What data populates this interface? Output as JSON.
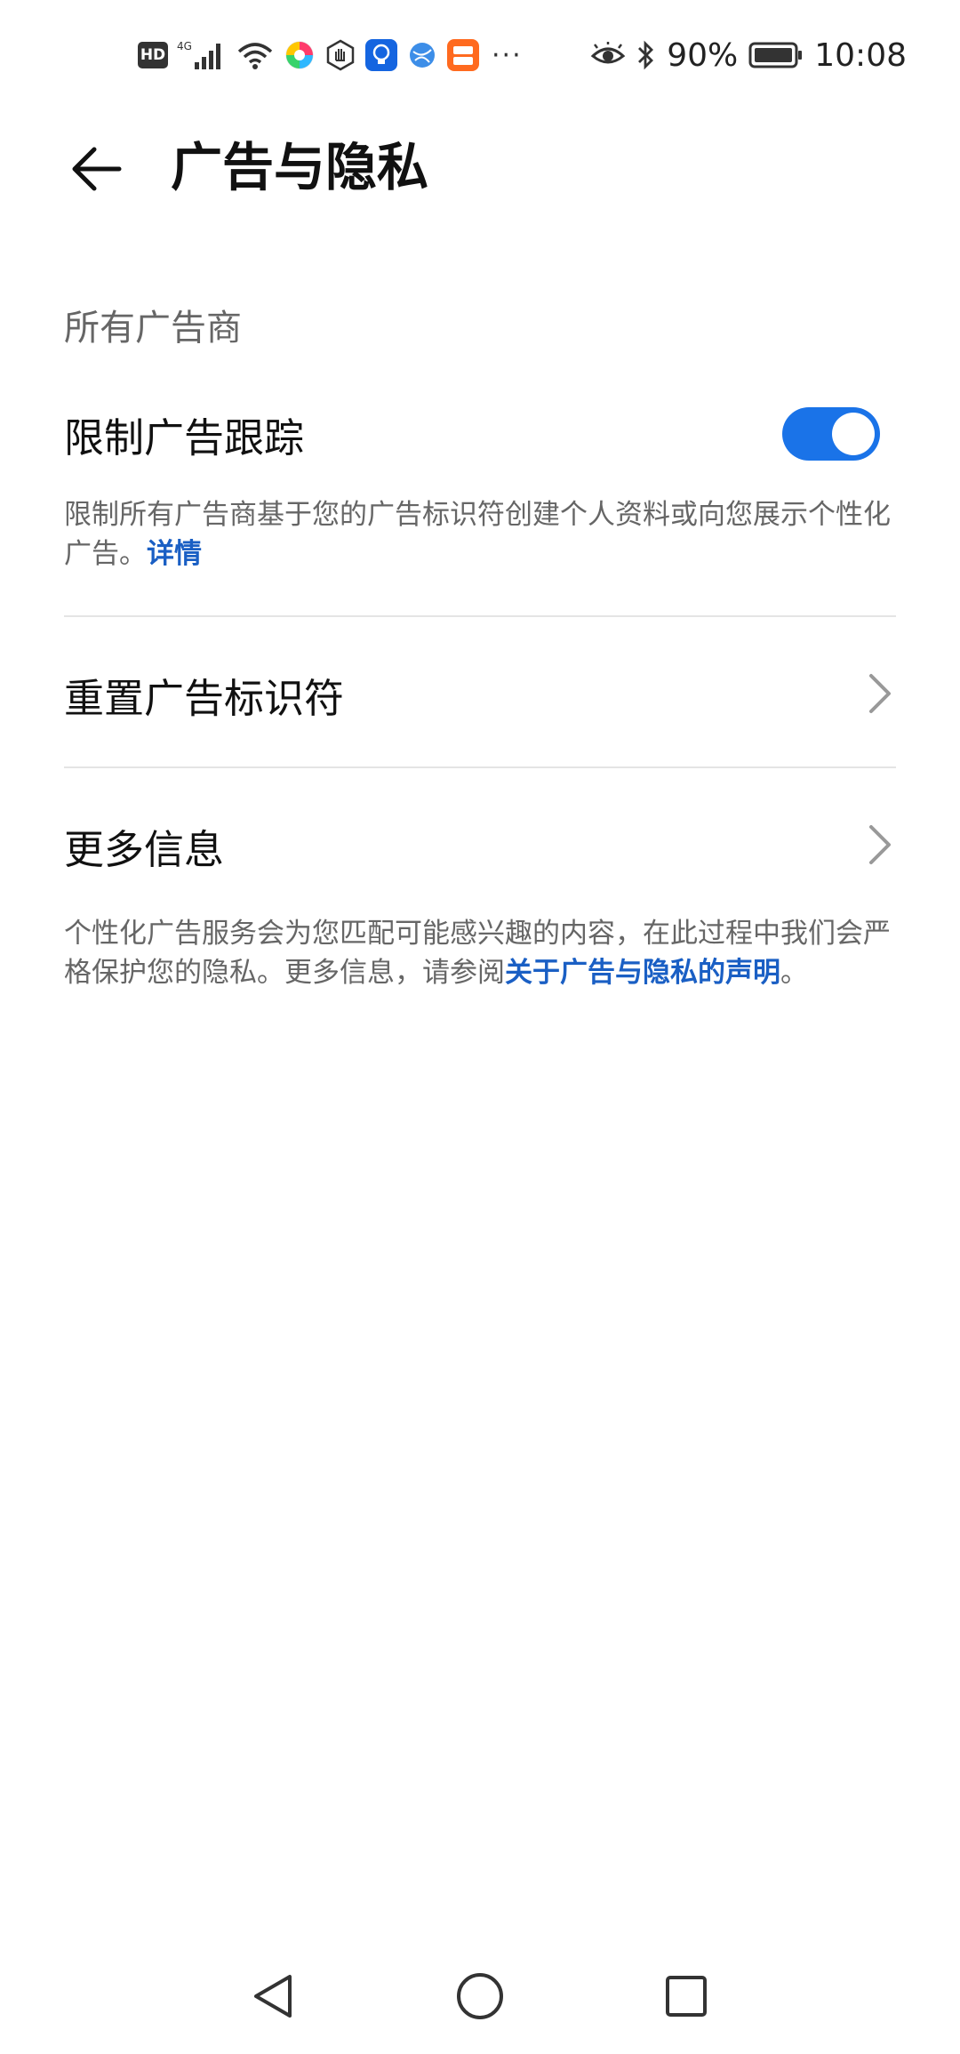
{
  "status_bar": {
    "battery": "90%",
    "time": "10:08",
    "left_icons": [
      "hd-badge",
      "4g-signal-icon",
      "wifi-icon",
      "app-icon-1",
      "app-icon-2",
      "app-icon-3",
      "app-icon-4",
      "app-icon-5"
    ],
    "right_icons": [
      "eye-icon",
      "bluetooth-icon",
      "battery-icon"
    ],
    "hd_label": "HD",
    "more": "···"
  },
  "header": {
    "title": "广告与隐私"
  },
  "section": {
    "label": "所有广告商"
  },
  "limit_tracking": {
    "title": "限制广告跟踪",
    "enabled": true,
    "description": "限制所有广告商基于您的广告标识符创建个人资料或向您展示个性化广告。",
    "link_label": "详情"
  },
  "reset_id": {
    "title": "重置广告标识符"
  },
  "more_info": {
    "title": "更多信息"
  },
  "footer_note": {
    "text": "个性化广告服务会为您匹配可能感兴趣的内容，在此过程中我们会严格保护您的隐私。更多信息，请参阅",
    "link_label": "关于广告与隐私的声明",
    "suffix": "。"
  },
  "colors": {
    "accent": "#1a73e8",
    "link": "#1a5fc4",
    "text_primary": "#111111",
    "text_secondary": "#666666",
    "divider": "#e4e4e4"
  }
}
